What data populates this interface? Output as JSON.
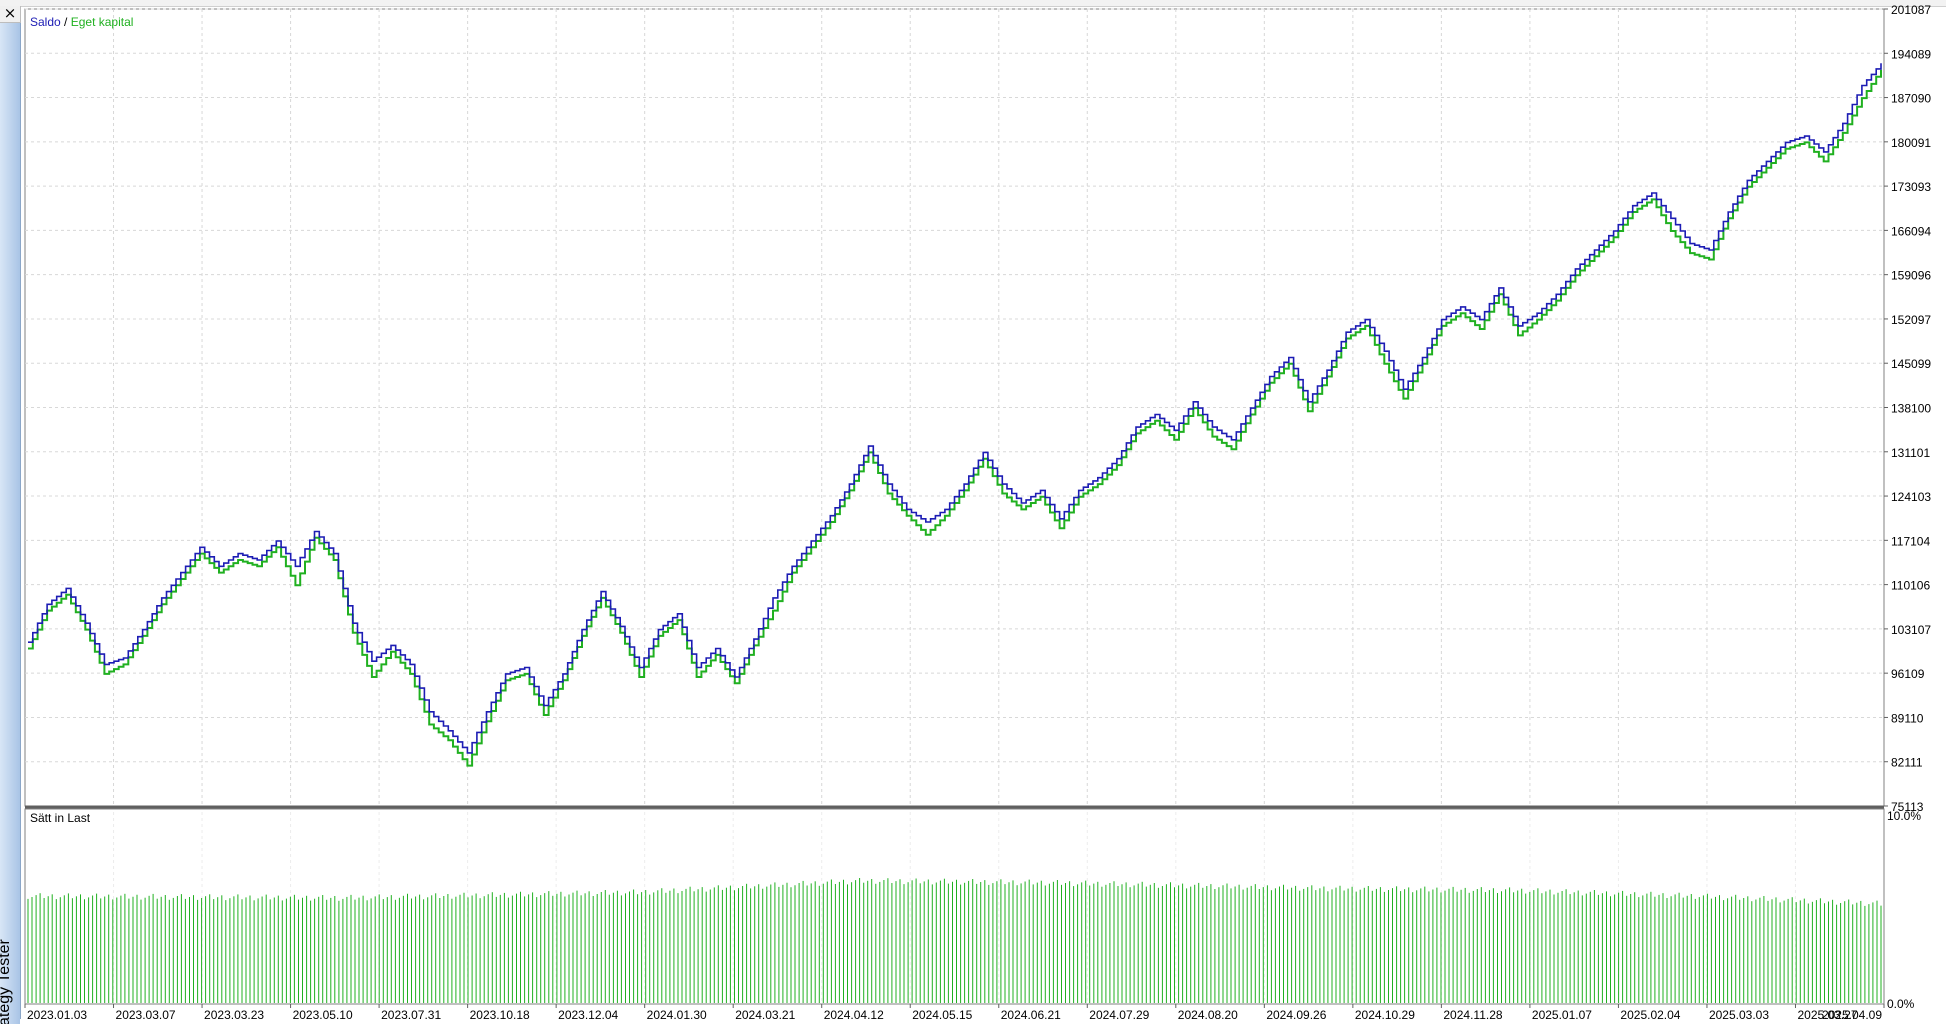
{
  "window": {
    "close_glyph": "×",
    "sidebar_label": "ategy Tester"
  },
  "chart_data": [
    {
      "type": "line",
      "legend_placement": "top-left",
      "legend": [
        {
          "name": "Saldo",
          "color": "#1c1cb4"
        },
        {
          "name": "Eget kapital",
          "color": "#20b020"
        }
      ],
      "separator": " / ",
      "grid": true,
      "ylim": [
        75113,
        201087
      ],
      "y_ticks": [
        "201087",
        "194089",
        "187090",
        "180091",
        "173093",
        "166094",
        "159096",
        "152097",
        "145099",
        "138100",
        "131101",
        "124103",
        "117104",
        "110106",
        "103107",
        "96109",
        "89110",
        "82111",
        "75113"
      ],
      "x_ticks": [
        "2023.01.03",
        "2023.03.07",
        "2023.03.23",
        "2023.05.10",
        "2023.07.31",
        "2023.10.18",
        "2023.12.04",
        "2024.01.30",
        "2024.03.21",
        "2024.04.12",
        "2024.05.15",
        "2024.06.21",
        "2024.07.29",
        "2024.08.20",
        "2024.09.26",
        "2024.10.29",
        "2024.11.28",
        "2025.01.07",
        "2025.02.04",
        "2025.03.03",
        "2025.03.27",
        "2025.04.09"
      ],
      "series": [
        {
          "name": "Saldo",
          "color": "#1c1cb4",
          "points": [
            [
              0,
              101000
            ],
            [
              1,
              107000
            ],
            [
              2,
              109500
            ],
            [
              3,
              104000
            ],
            [
              4,
              97500
            ],
            [
              5,
              98500
            ],
            [
              6,
              103000
            ],
            [
              7,
              108000
            ],
            [
              8,
              112000
            ],
            [
              9,
              116000
            ],
            [
              10,
              113000
            ],
            [
              11,
              115000
            ],
            [
              12,
              114000
            ],
            [
              13,
              117000
            ],
            [
              14,
              113000
            ],
            [
              15,
              118500
            ],
            [
              16,
              115000
            ],
            [
              17,
              104000
            ],
            [
              18,
              98000
            ],
            [
              19,
              100500
            ],
            [
              20,
              97500
            ],
            [
              21,
              90000
            ],
            [
              22,
              87000
            ],
            [
              23,
              83500
            ],
            [
              24,
              90000
            ],
            [
              25,
              96000
            ],
            [
              26,
              97000
            ],
            [
              27,
              91000
            ],
            [
              28,
              96000
            ],
            [
              29,
              103000
            ],
            [
              30,
              109000
            ],
            [
              31,
              103500
            ],
            [
              32,
              97000
            ],
            [
              33,
              103000
            ],
            [
              34,
              105500
            ],
            [
              35,
              97000
            ],
            [
              36,
              100000
            ],
            [
              37,
              95500
            ],
            [
              38,
              101500
            ],
            [
              39,
              108000
            ],
            [
              40,
              113000
            ],
            [
              41,
              117000
            ],
            [
              42,
              121000
            ],
            [
              43,
              126000
            ],
            [
              44,
              132000
            ],
            [
              45,
              126000
            ],
            [
              46,
              122000
            ],
            [
              47,
              120000
            ],
            [
              48,
              122000
            ],
            [
              49,
              126000
            ],
            [
              50,
              131000
            ],
            [
              51,
              126000
            ],
            [
              52,
              123000
            ],
            [
              53,
              125000
            ],
            [
              54,
              120500
            ],
            [
              55,
              125000
            ],
            [
              56,
              127000
            ],
            [
              57,
              130000
            ],
            [
              58,
              135000
            ],
            [
              59,
              137000
            ],
            [
              60,
              134500
            ],
            [
              61,
              139000
            ],
            [
              62,
              135000
            ],
            [
              63,
              133000
            ],
            [
              64,
              138000
            ],
            [
              65,
              143000
            ],
            [
              66,
              146000
            ],
            [
              67,
              139000
            ],
            [
              68,
              144000
            ],
            [
              69,
              150000
            ],
            [
              70,
              152000
            ],
            [
              71,
              147000
            ],
            [
              72,
              141000
            ],
            [
              73,
              146000
            ],
            [
              74,
              152000
            ],
            [
              75,
              154000
            ],
            [
              76,
              152000
            ],
            [
              77,
              157000
            ],
            [
              78,
              151000
            ],
            [
              79,
              153000
            ],
            [
              80,
              156000
            ],
            [
              81,
              160000
            ],
            [
              82,
              163000
            ],
            [
              83,
              166000
            ],
            [
              84,
              170000
            ],
            [
              85,
              172000
            ],
            [
              86,
              168000
            ],
            [
              87,
              164000
            ],
            [
              88,
              163000
            ],
            [
              89,
              169000
            ],
            [
              90,
              174000
            ],
            [
              91,
              177000
            ],
            [
              92,
              180000
            ],
            [
              93,
              181000
            ],
            [
              94,
              178500
            ],
            [
              95,
              183000
            ],
            [
              96,
              189000
            ],
            [
              97,
              192500
            ]
          ]
        },
        {
          "name": "Eget kapital",
          "color": "#20b020",
          "points": [
            [
              0,
              100000
            ],
            [
              1,
              106000
            ],
            [
              2,
              108500
            ],
            [
              3,
              103000
            ],
            [
              4,
              96000
            ],
            [
              5,
              97500
            ],
            [
              6,
              102000
            ],
            [
              7,
              107000
            ],
            [
              8,
              111000
            ],
            [
              9,
              115000
            ],
            [
              10,
              112000
            ],
            [
              11,
              114000
            ],
            [
              12,
              113000
            ],
            [
              13,
              116000
            ],
            [
              14,
              110000
            ],
            [
              15,
              117500
            ],
            [
              16,
              114000
            ],
            [
              17,
              102500
            ],
            [
              18,
              95500
            ],
            [
              19,
              99500
            ],
            [
              20,
              96000
            ],
            [
              21,
              88000
            ],
            [
              22,
              85500
            ],
            [
              23,
              81500
            ],
            [
              24,
              88500
            ],
            [
              25,
              95000
            ],
            [
              26,
              96000
            ],
            [
              27,
              89500
            ],
            [
              28,
              95000
            ],
            [
              29,
              102000
            ],
            [
              30,
              108000
            ],
            [
              31,
              102500
            ],
            [
              32,
              95500
            ],
            [
              33,
              102000
            ],
            [
              34,
              104500
            ],
            [
              35,
              95500
            ],
            [
              36,
              99000
            ],
            [
              37,
              94500
            ],
            [
              38,
              100500
            ],
            [
              39,
              106000
            ],
            [
              40,
              112000
            ],
            [
              41,
              116000
            ],
            [
              42,
              120000
            ],
            [
              43,
              125000
            ],
            [
              44,
              131000
            ],
            [
              45,
              124500
            ],
            [
              46,
              121000
            ],
            [
              47,
              118000
            ],
            [
              48,
              121000
            ],
            [
              49,
              125000
            ],
            [
              50,
              130000
            ],
            [
              51,
              124500
            ],
            [
              52,
              122000
            ],
            [
              53,
              124000
            ],
            [
              54,
              119000
            ],
            [
              55,
              124000
            ],
            [
              56,
              126000
            ],
            [
              57,
              129000
            ],
            [
              58,
              134000
            ],
            [
              59,
              136000
            ],
            [
              60,
              133000
            ],
            [
              61,
              138000
            ],
            [
              62,
              133500
            ],
            [
              63,
              131500
            ],
            [
              64,
              137000
            ],
            [
              65,
              142000
            ],
            [
              66,
              145000
            ],
            [
              67,
              137500
            ],
            [
              68,
              143000
            ],
            [
              69,
              149000
            ],
            [
              70,
              151000
            ],
            [
              71,
              145000
            ],
            [
              72,
              139500
            ],
            [
              73,
              145000
            ],
            [
              74,
              151000
            ],
            [
              75,
              153000
            ],
            [
              76,
              150500
            ],
            [
              77,
              156000
            ],
            [
              78,
              149500
            ],
            [
              79,
              152000
            ],
            [
              80,
              155000
            ],
            [
              81,
              159000
            ],
            [
              82,
              162000
            ],
            [
              83,
              165000
            ],
            [
              84,
              169000
            ],
            [
              85,
              171000
            ],
            [
              86,
              166000
            ],
            [
              87,
              162500
            ],
            [
              88,
              161500
            ],
            [
              89,
              168000
            ],
            [
              90,
              173000
            ],
            [
              91,
              176000
            ],
            [
              92,
              179000
            ],
            [
              93,
              180000
            ],
            [
              94,
              177000
            ],
            [
              95,
              181500
            ],
            [
              96,
              187000
            ],
            [
              97,
              191500
            ]
          ]
        }
      ]
    },
    {
      "type": "bar",
      "label": "Sätt in Last",
      "label_color": "#000000",
      "color": "#20b020",
      "ylim": [
        0,
        10
      ],
      "y_ticks": [
        "10.0%",
        "0.0%"
      ],
      "bar_count": 460,
      "load_profile_pct": [
        [
          0,
          5.6
        ],
        [
          0.17,
          5.5
        ],
        [
          0.33,
          5.8
        ],
        [
          0.45,
          6.4
        ],
        [
          0.55,
          6.3
        ],
        [
          0.7,
          6.0
        ],
        [
          0.8,
          5.9
        ],
        [
          0.9,
          5.6
        ],
        [
          1.0,
          5.2
        ]
      ]
    }
  ]
}
